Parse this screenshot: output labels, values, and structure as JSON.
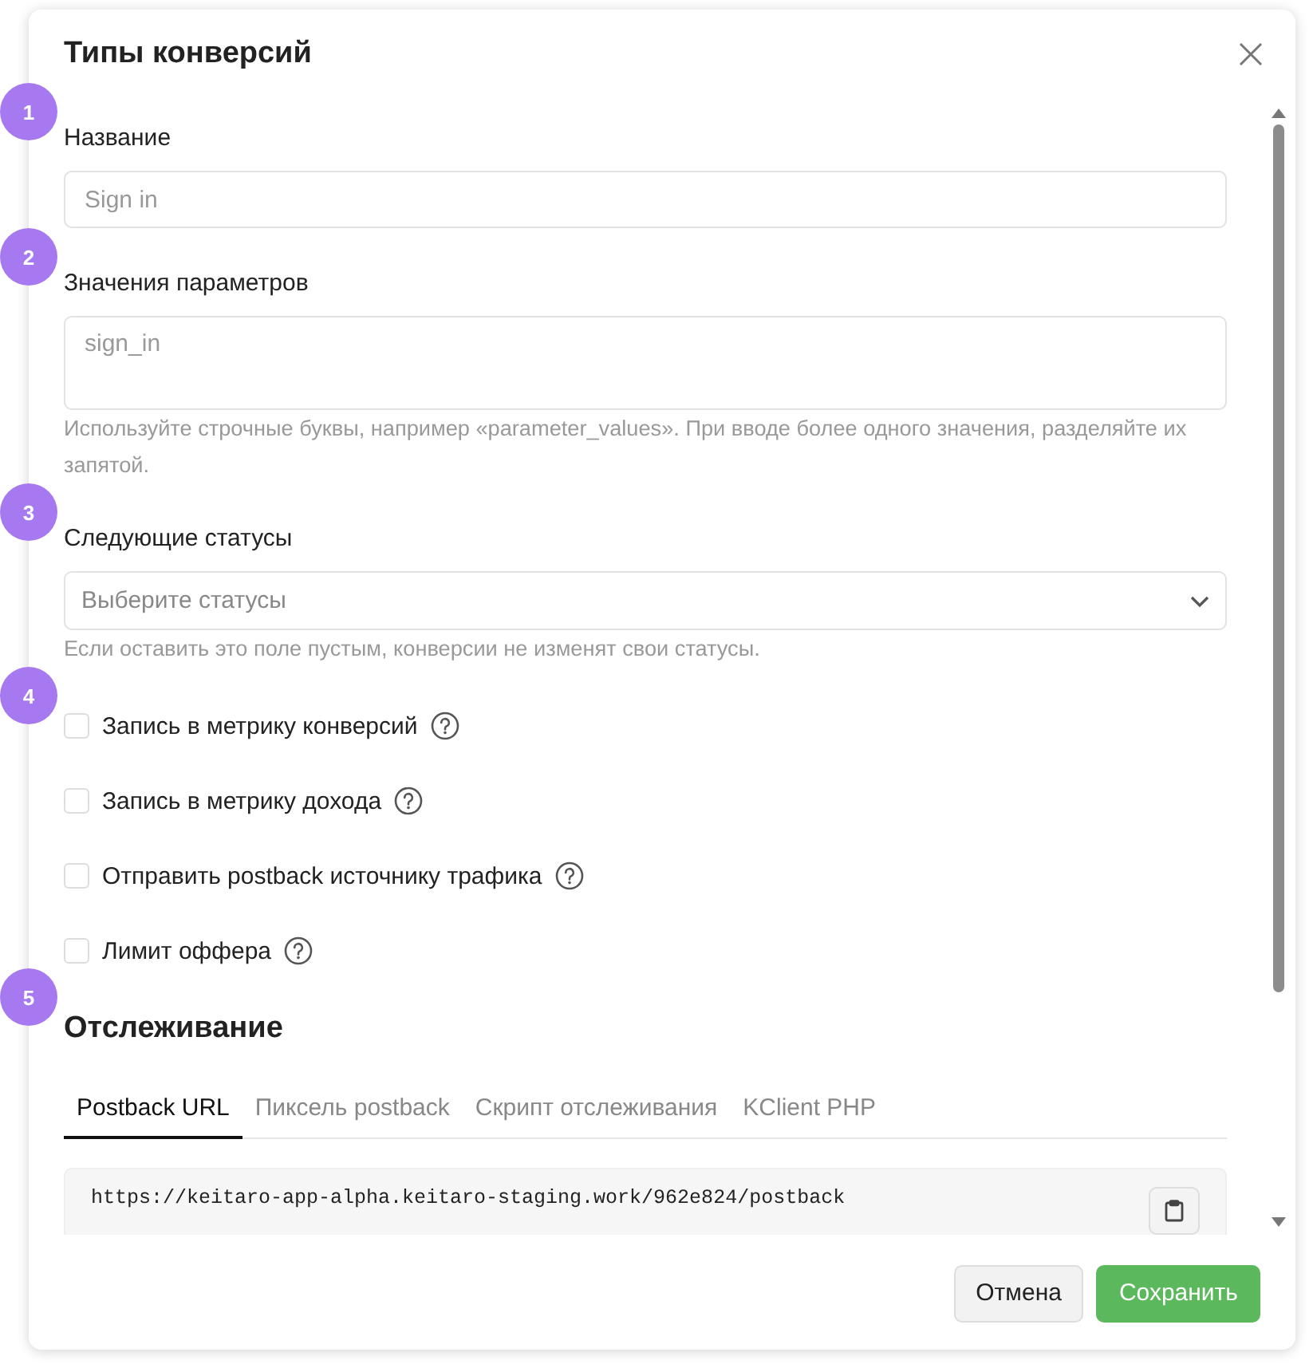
{
  "dialog": {
    "title": "Типы конверсий"
  },
  "fields": [
    {
      "kind": "input",
      "marker": "1",
      "label": "Название",
      "placeholder": "Sign in"
    },
    {
      "kind": "textarea",
      "marker": "2",
      "label": "Значения параметров",
      "placeholder": "sign_in",
      "hint": "Используйте строчные буквы, например «parameter_values». При вводе более одного значения, разделяйте их запятой."
    },
    {
      "kind": "select",
      "marker": "3",
      "label": "Следующие статусы",
      "placeholder": "Выберите статусы",
      "hint": "Если оставить это поле пустым, конверсии не изменят свои статусы."
    }
  ],
  "options": {
    "marker": "4",
    "items": [
      {
        "label": "Запись в метрику конверсий",
        "checked": false
      },
      {
        "label": "Запись в метрику дохода",
        "checked": false
      },
      {
        "label": "Отправить postback источнику трафика",
        "checked": false
      },
      {
        "label": "Лимит оффера",
        "checked": false
      }
    ]
  },
  "tracking": {
    "marker": "5",
    "title": "Отслеживание",
    "tabs": [
      {
        "label": "Postback URL",
        "selected": true
      },
      {
        "label": "Пиксель postback",
        "selected": false
      },
      {
        "label": "Скрипт отслеживания",
        "selected": false
      },
      {
        "label": "KClient PHP",
        "selected": false
      }
    ],
    "url": "https://keitaro-app-alpha.keitaro-staging.work/962e824/postback"
  },
  "buttons": [
    {
      "kind": "secondary",
      "label": "Отмена"
    },
    {
      "kind": "primary",
      "label": "Сохранить"
    }
  ]
}
